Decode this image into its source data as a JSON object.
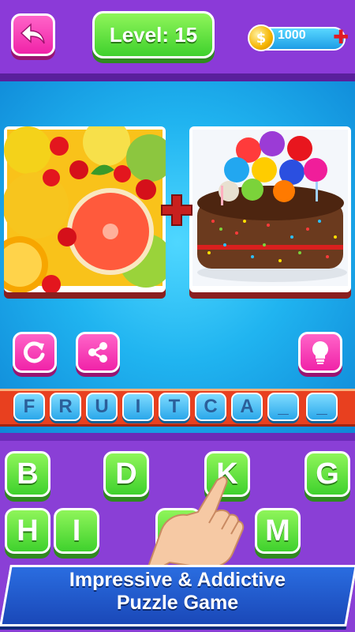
{
  "header": {
    "back_icon": "back-arrow-icon",
    "level_label": "Level: 15",
    "coins": {
      "icon": "coin-icon",
      "symbol": "$",
      "value": "1000",
      "add_icon": "plus-icon"
    }
  },
  "puzzle": {
    "image_left": "fruit slices (oranges, cherries, grapefruit)",
    "image_right": "birthday cake with balloons and sprinkles",
    "plus_icon": "plus-icon"
  },
  "actions": {
    "refresh_icon": "refresh-icon",
    "share_icon": "share-icon",
    "hint_icon": "lightbulb-icon"
  },
  "answer": {
    "slots": [
      "F",
      "R",
      "U",
      "I",
      "T",
      "C",
      "A",
      "_",
      "_"
    ]
  },
  "keyboard": {
    "keys": [
      "B",
      "D",
      "K",
      "G",
      "H",
      "I",
      "",
      "M"
    ]
  },
  "banner": {
    "line1": "Impressive & Addictive",
    "line2": "Puzzle Game"
  },
  "colors": {
    "purple": "#8a3fd6",
    "pink_button": "#f023a8",
    "green_button": "#3fd12d",
    "answer_bar": "#e8401f",
    "sky_blue": "#20b4f0"
  }
}
